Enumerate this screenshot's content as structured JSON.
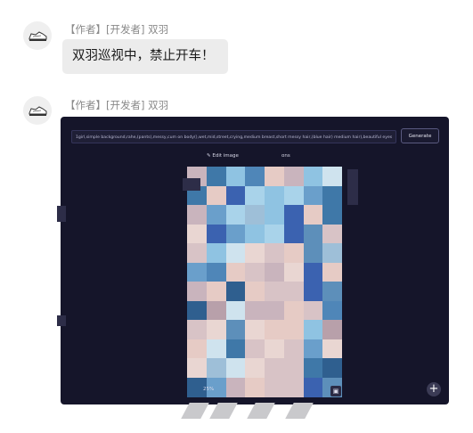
{
  "messages": [
    {
      "sender": "【作者】[开发者] 双羽",
      "text": "双羽巡视中，禁止开车！"
    },
    {
      "sender": "【作者】[开发者] 双羽",
      "screenshot": {
        "prompt": "1girl,simple background,rahe,(pants),messy,cum on body(),wet,mid,street,crying,medium breast,short messy hair,(blue hair) medium hair),beautiful eyes",
        "generate_label": "Generate",
        "edit_label": "Edit image",
        "options_label": "ons",
        "zoom_label": "25%"
      }
    }
  ],
  "icons": {
    "avatar": "sneaker-icon",
    "edit": "pencil-icon",
    "save": "save-icon",
    "add": "plus-icon"
  },
  "colors": {
    "bubble": "#ececec",
    "screenshot_bg": "#15152a"
  }
}
